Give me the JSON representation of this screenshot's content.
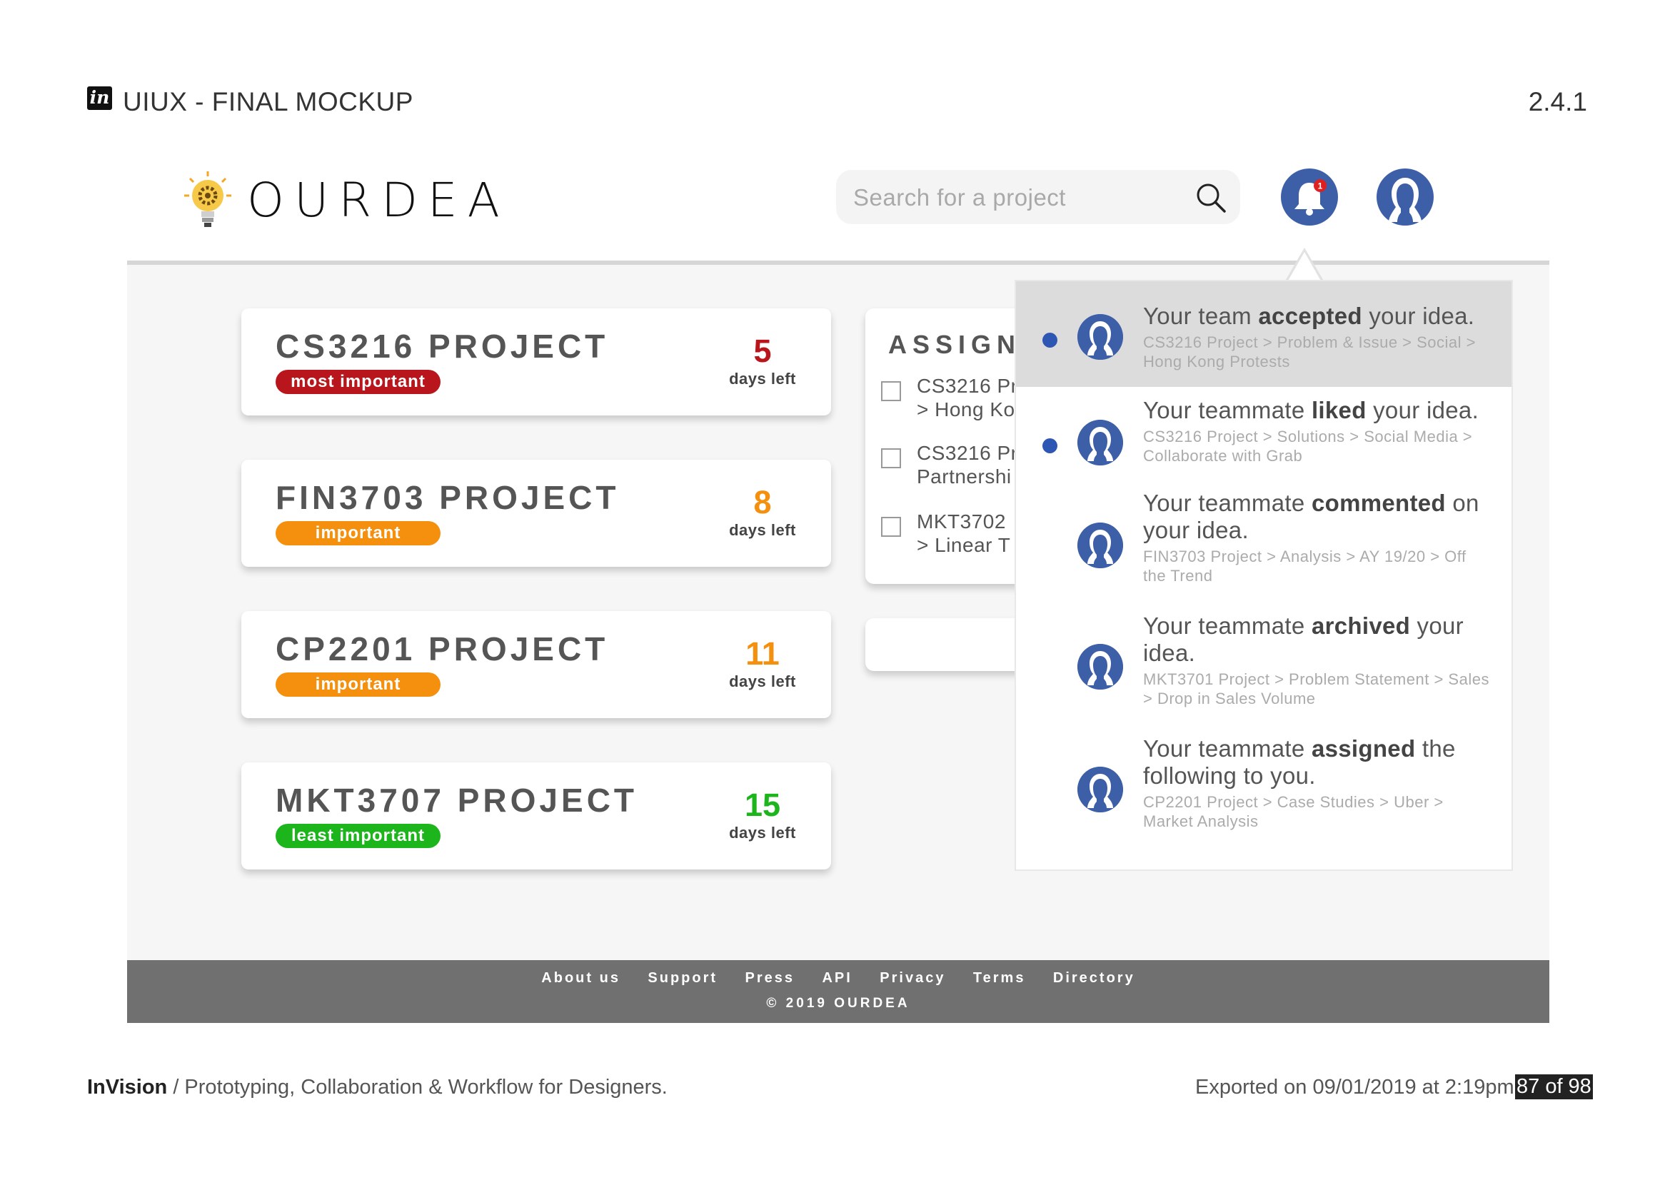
{
  "export_header": {
    "title": "UIUX - FINAL MOCKUP",
    "version": "2.4.1",
    "logo": "in"
  },
  "app": {
    "brand": "OURDEA",
    "search": {
      "placeholder": "Search for a project",
      "value": ""
    },
    "notification_count": "1"
  },
  "projects": [
    {
      "name": "CS3216 PROJECT",
      "priority": "most important",
      "days": "5",
      "days_label": "days left",
      "color": "#b8161c"
    },
    {
      "name": "FIN3703 PROJECT",
      "priority": "important",
      "days": "8",
      "days_label": "days left",
      "color": "#f5900e"
    },
    {
      "name": "CP2201 PROJECT",
      "priority": "important",
      "days": "11",
      "days_label": "days left",
      "color": "#f5900e"
    },
    {
      "name": "MKT3707 PROJECT",
      "priority": "least important",
      "days": "15",
      "days_label": "days left",
      "color": "#1cb51c"
    }
  ],
  "assigned": {
    "title": "ASSIGNE",
    "items": [
      {
        "line1": "CS3216 Pr",
        "line2": "> Hong Ko"
      },
      {
        "line1": "CS3216 Pr",
        "line2": "Partnershi"
      },
      {
        "line1": "MKT3702",
        "line2": "> Linear T"
      }
    ]
  },
  "notifications": [
    {
      "pre": "Your team ",
      "bold": "accepted",
      "post": " your idea.",
      "path": "CS3216 Project > Problem & Issue > Social > Hong Kong Protests",
      "unread": true,
      "highlighted": true
    },
    {
      "pre": "Your teammate ",
      "bold": "liked",
      "post": " your idea.",
      "path": "CS3216 Project > Solutions > Social Media > Collaborate with Grab",
      "unread": true,
      "highlighted": false
    },
    {
      "pre": "Your teammate ",
      "bold": "commented",
      "post": " on your idea.",
      "path": "FIN3703 Project > Analysis > AY 19/20 > Off the Trend",
      "unread": false,
      "highlighted": false
    },
    {
      "pre": "Your teammate ",
      "bold": "archived",
      "post": " your idea.",
      "path": "MKT3701 Project > Problem Statement > Sales > Drop in Sales Volume",
      "unread": false,
      "highlighted": false
    },
    {
      "pre": "Your teammate ",
      "bold": "assigned",
      "post": " the following to you.",
      "path": "CP2201 Project > Case Studies > Uber > Market Analysis",
      "unread": false,
      "highlighted": false
    }
  ],
  "footer": {
    "links": [
      "About us",
      "Support",
      "Press",
      "API",
      "Privacy",
      "Terms",
      "Directory"
    ],
    "copyright": "© 2019 OURDEA"
  },
  "export_footer": {
    "brand": "InVision",
    "tagline": " / Prototyping, Collaboration & Workflow for Designers.",
    "exported": "Exported on 09/01/2019 at 2:19pm",
    "pages": "87 of 98"
  },
  "icons": {
    "logo": "lightbulb-gear-icon",
    "search": "search-icon",
    "notifications": "bell-icon",
    "profile": "user-avatar-icon",
    "checkbox": "checkbox-icon"
  },
  "colors": {
    "accent_blue": "#3d5fa8",
    "unread_dot": "#2e57b3",
    "footer_gray": "#707070",
    "badge_red": "#e02020"
  }
}
